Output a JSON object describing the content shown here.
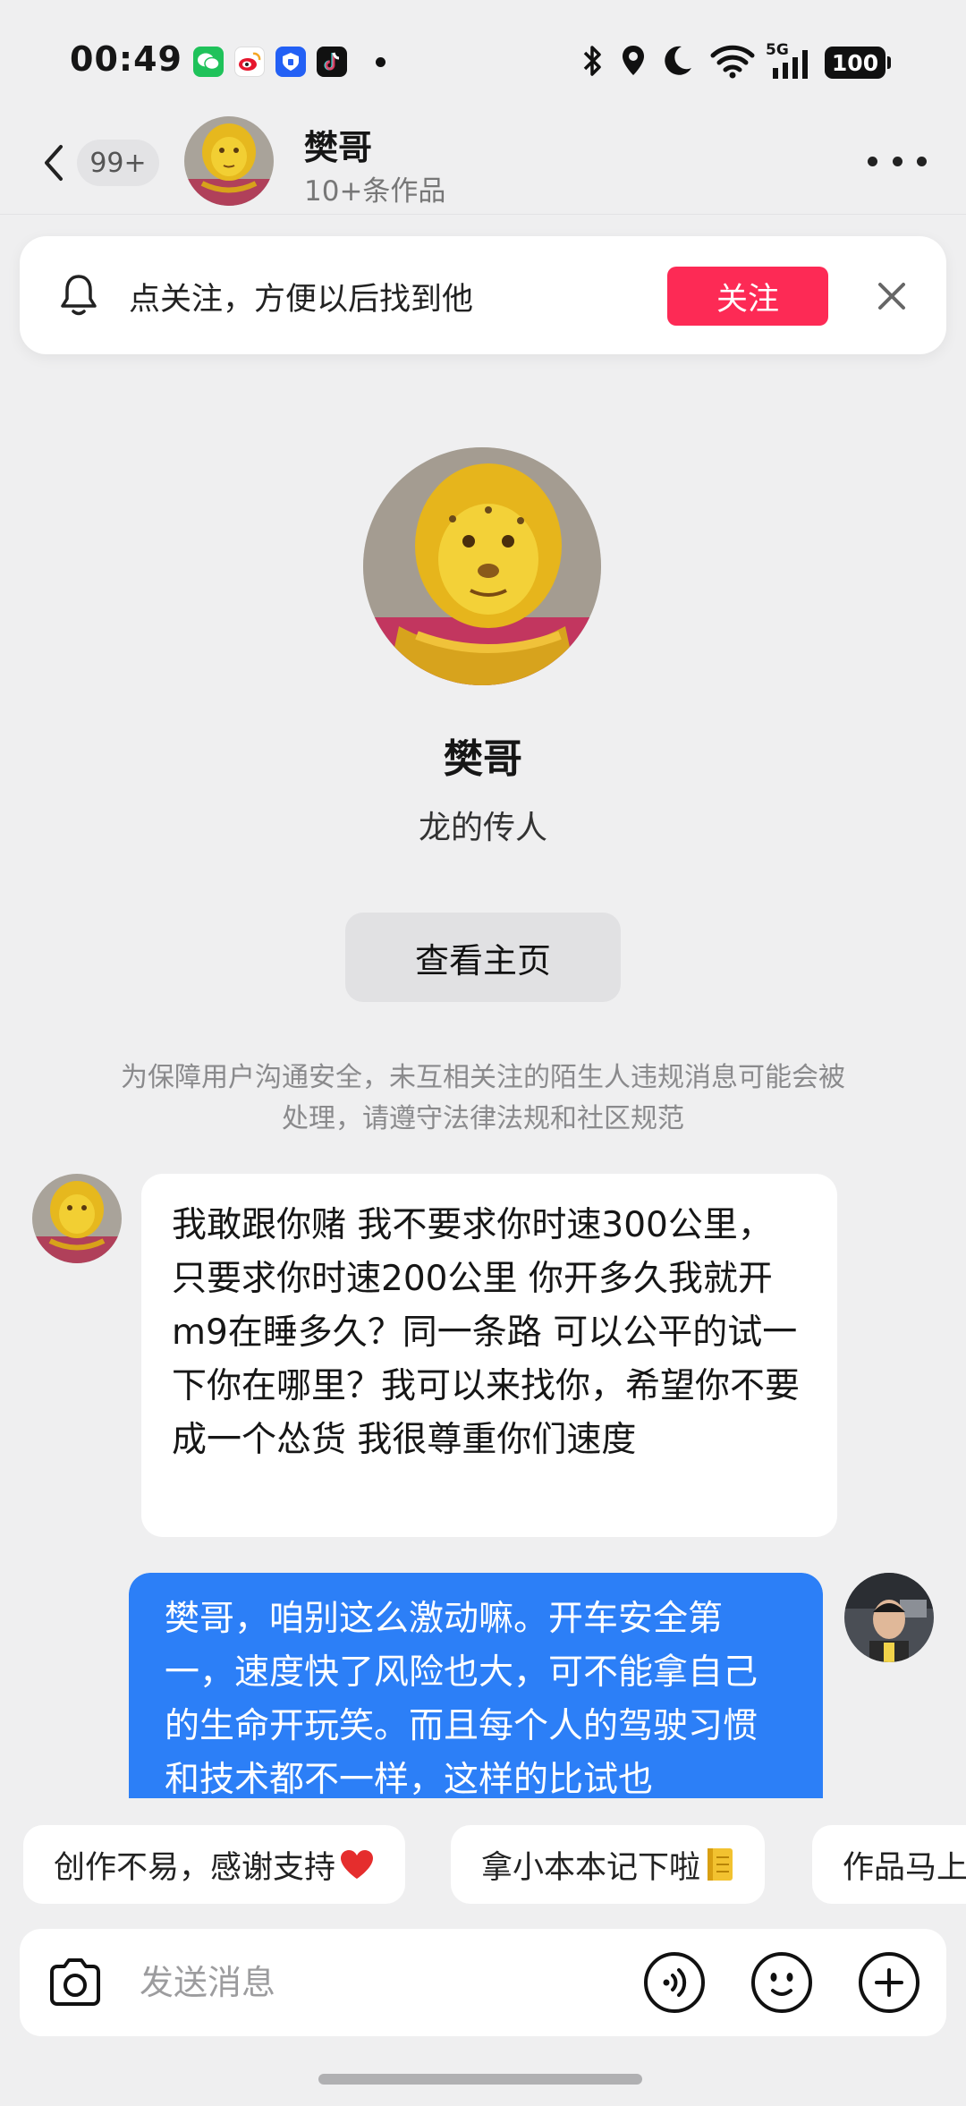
{
  "status_bar": {
    "time": "00:49",
    "app_icons": [
      "wechat-icon",
      "weibo-icon",
      "security-app-icon",
      "tiktok-icon"
    ],
    "network": "5G",
    "battery": "100"
  },
  "header": {
    "unread_count": "99+",
    "contact_name": "樊哥",
    "works_count": "10+条作品"
  },
  "follow_banner": {
    "text": "点关注，方便以后找到他",
    "button": "关注"
  },
  "profile": {
    "name": "樊哥",
    "bio": "龙的传人",
    "view_home_button": "查看主页"
  },
  "safety_notice": "为保障用户沟通安全，未互相关注的陌生人违规消息可能会被处理，请遵守法律法规和社区规范",
  "messages": [
    {
      "from": "other",
      "text": "我敢跟你赌  我不要求你时速300公里，只要求你时速200公里  你开多久我就开m9在睡多久？同一条路  可以公平的试一下你在哪里？我可以来找你，希望你不要成一个怂货  我很尊重你们速度"
    },
    {
      "from": "me",
      "text": "樊哥，咱别这么激动嘛。开车安全第一，速度快了风险也大，可不能拿自己的生命开玩笑。而且每个人的驾驶习惯和技术都不一样，这样的比试也"
    }
  ],
  "quick_replies": [
    {
      "label": "创作不易，感谢支持",
      "emoji": "heart-icon"
    },
    {
      "label": "拿小本本记下啦",
      "emoji": "notebook-icon"
    },
    {
      "label": "作品马上",
      "emoji": ""
    }
  ],
  "input": {
    "placeholder": "发送消息"
  },
  "colors": {
    "accent_red": "#fd2a55",
    "bubble_blue": "#2c7ff7",
    "background": "#efeff0"
  }
}
